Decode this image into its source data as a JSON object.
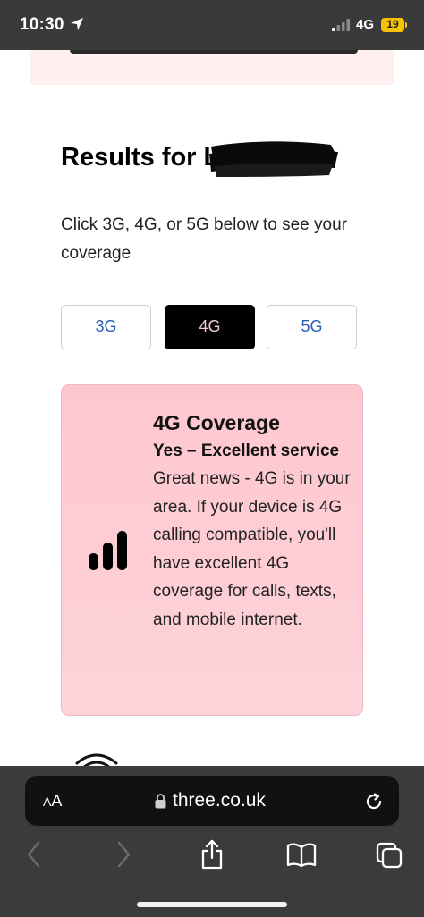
{
  "status_bar": {
    "time": "10:30",
    "network": "4G",
    "battery": "19"
  },
  "results": {
    "title": "Results for LE5",
    "instruction": "Click 3G, 4G, or 5G below to see your coverage"
  },
  "network_tabs": [
    {
      "label": "3G",
      "selected": false
    },
    {
      "label": "4G",
      "selected": true
    },
    {
      "label": "5G",
      "selected": false
    }
  ],
  "coverage_card": {
    "title": "4G Coverage",
    "status": "Yes – Excellent service",
    "description": "Great news - 4G is in your area. If your device is 4G calling compatible, you'll have excellent 4G coverage for calls, texts, and mobile internet.",
    "icon": "signal-bars-icon"
  },
  "browser": {
    "aa_label_small": "A",
    "aa_label_large": "A",
    "url": "three.co.uk"
  },
  "colors": {
    "status_bar_bg": "#3a3a3a",
    "tab_text": "#2b5fb6",
    "active_tab_bg": "#000000",
    "active_tab_text": "#f7c7d0",
    "card_bg": "#fec7cf",
    "battery": "#f5c400"
  }
}
